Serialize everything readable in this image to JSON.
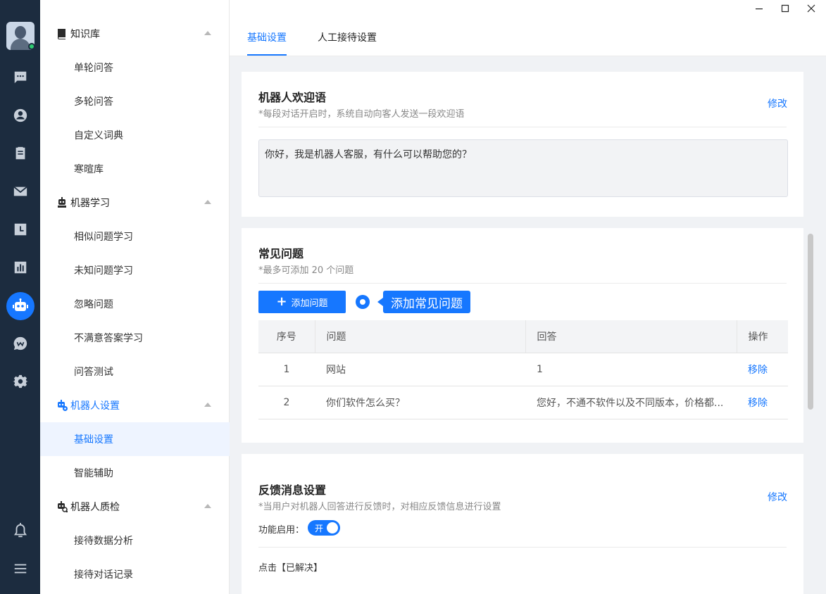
{
  "tabs": [
    {
      "label": "基础设置"
    },
    {
      "label": "人工接待设置"
    }
  ],
  "sidebar": {
    "groups": [
      {
        "label": "知识库",
        "icon": "book-icon",
        "items": [
          "单轮问答",
          "多轮问答",
          "自定义词典",
          "寒暄库"
        ]
      },
      {
        "label": "机器学习",
        "icon": "robot-learn-icon",
        "items": [
          "相似问题学习",
          "未知问题学习",
          "忽略问题",
          "不满意答案学习",
          "问答测试"
        ]
      },
      {
        "label": "机器人设置",
        "icon": "robot-settings-icon",
        "items": [
          "基础设置",
          "智能辅助"
        ]
      },
      {
        "label": "机器人质检",
        "icon": "robot-qc-icon",
        "items": [
          "接待数据分析",
          "接待对话记录"
        ]
      }
    ],
    "selected_item": "基础设置"
  },
  "welcome": {
    "title": "机器人欢迎语",
    "subtitle": "*每段对话开启时，系统自动向客人发送一段欢迎语",
    "edit_label": "修改",
    "message": "你好，我是机器人客服，有什么可以帮助您的？"
  },
  "faq": {
    "title": "常见问题",
    "subtitle": "*最多可添加 20 个问题",
    "add_button": "添加问题",
    "hint": "添加常见问题",
    "columns": [
      "序号",
      "问题",
      "回答",
      "操作"
    ],
    "rows": [
      {
        "index": "1",
        "question": "网站",
        "answer": "1",
        "action": "移除"
      },
      {
        "index": "2",
        "question": "你们软件怎么买？",
        "answer": "您好，不通不软件以及不同版本，价格都...",
        "action": "移除"
      }
    ]
  },
  "feedback": {
    "title": "反馈消息设置",
    "subtitle": "*当用户对机器人回答进行反馈时，对相应反馈信息进行设置",
    "edit_label": "修改",
    "enable_label": "功能启用：",
    "toggle_label": "开",
    "toggle_on": true,
    "resolved_label": "点击【已解决】"
  },
  "colors": {
    "accent": "#1677ff",
    "rail": "#1c2c3f"
  }
}
